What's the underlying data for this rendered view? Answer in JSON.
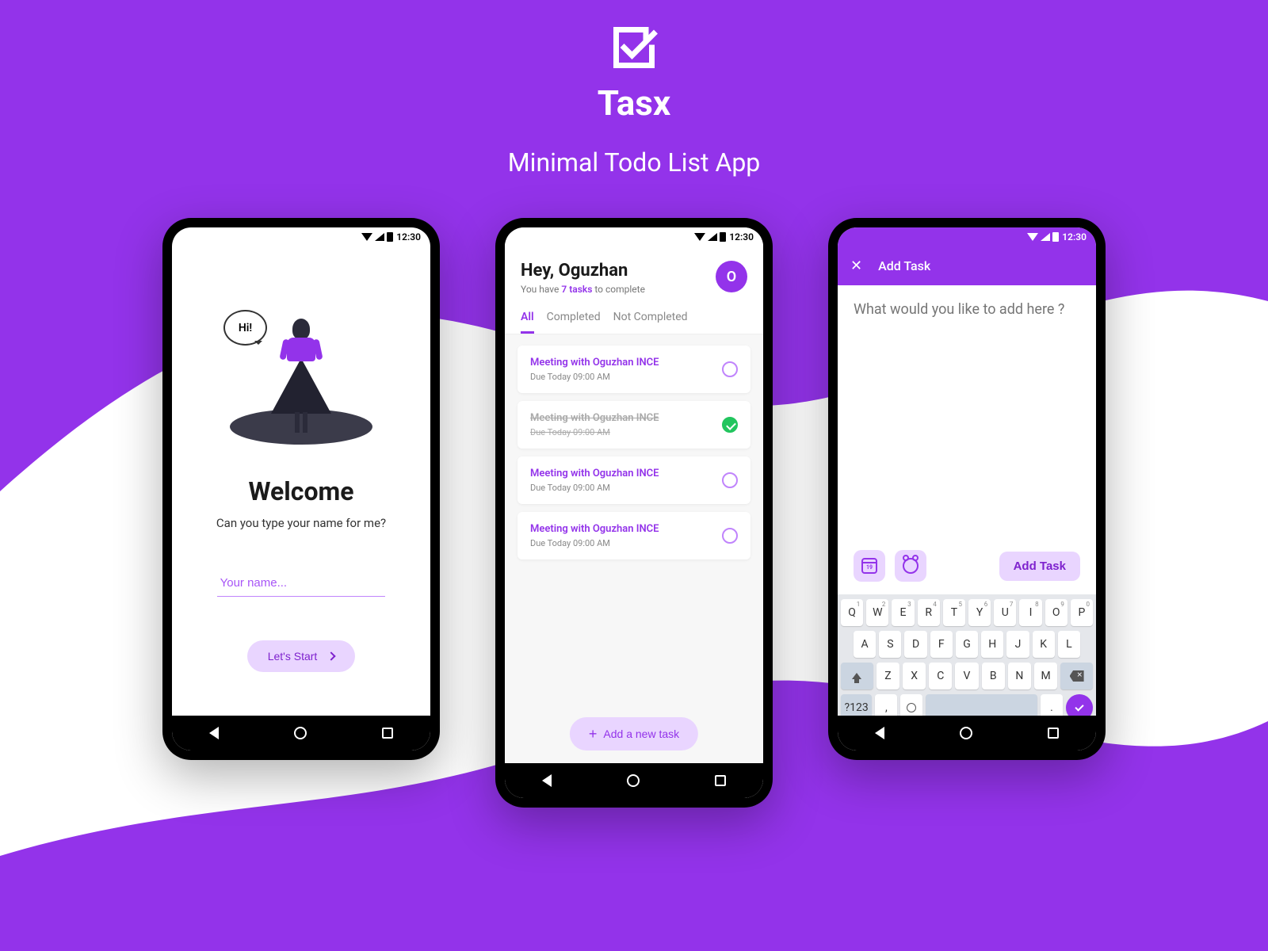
{
  "brand": {
    "name": "Tasx",
    "tagline": "Minimal Todo List App"
  },
  "status": {
    "time": "12:30"
  },
  "welcome": {
    "bubble": "Hi!",
    "title": "Welcome",
    "subtitle": "Can you type your name for me?",
    "placeholder": "Your name...",
    "cta": "Let's Start"
  },
  "list": {
    "greeting": "Hey, Oguzhan",
    "sub_pre": "You have ",
    "task_count": "7 tasks",
    "sub_post": " to complete",
    "avatar_letter": "O",
    "filters": [
      "All",
      "Completed",
      "Not Completed"
    ],
    "tasks": [
      {
        "title": "Meeting with Oguzhan INCE",
        "due": "Due Today 09:00 AM",
        "done": false
      },
      {
        "title": "Meeting with Oguzhan INCE",
        "due": "Due Today 09:00 AM",
        "done": true
      },
      {
        "title": "Meeting with Oguzhan INCE",
        "due": "Due Today 09:00 AM",
        "done": false
      },
      {
        "title": "Meeting with Oguzhan INCE",
        "due": "Due Today 09:00 AM",
        "done": false
      }
    ],
    "add_cta": "Add a new task"
  },
  "add": {
    "title": "Add Task",
    "placeholder": "What would you like to add here ?",
    "submit": "Add Task",
    "calendar_day": "19"
  },
  "keyboard": {
    "row1": [
      {
        "k": "Q",
        "n": "1"
      },
      {
        "k": "W",
        "n": "2"
      },
      {
        "k": "E",
        "n": "3"
      },
      {
        "k": "R",
        "n": "4"
      },
      {
        "k": "T",
        "n": "5"
      },
      {
        "k": "Y",
        "n": "6"
      },
      {
        "k": "U",
        "n": "7"
      },
      {
        "k": "I",
        "n": "8"
      },
      {
        "k": "O",
        "n": "9"
      },
      {
        "k": "P",
        "n": "0"
      }
    ],
    "row2": [
      "A",
      "S",
      "D",
      "F",
      "G",
      "H",
      "J",
      "K",
      "L"
    ],
    "row3": [
      "Z",
      "X",
      "C",
      "V",
      "B",
      "N",
      "M"
    ],
    "sym": "?123",
    "comma": ",",
    "period": "."
  }
}
